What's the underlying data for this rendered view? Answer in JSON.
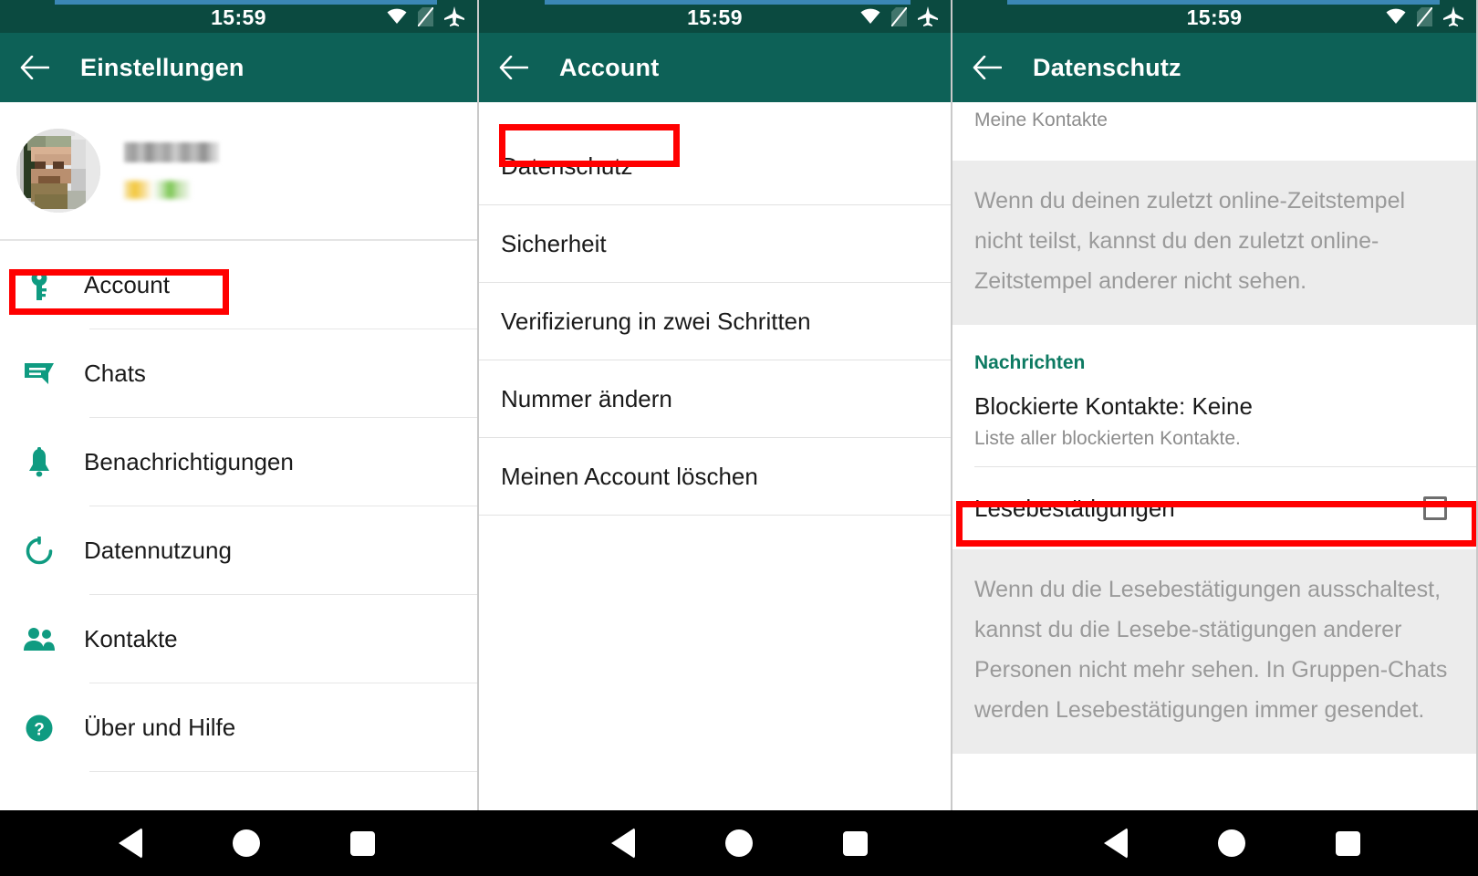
{
  "statusbar": {
    "time": "15:59",
    "icons": [
      "wifi-icon",
      "no-sim-icon",
      "airplane-mode-icon"
    ]
  },
  "colors": {
    "appbar_green": "#0d6157",
    "statusbar_green": "#0b4a40",
    "accent_teal": "#0d7a62",
    "progress_blue": "#3b87b5",
    "highlight_red": "#ff0000",
    "info_bg": "#ececec"
  },
  "panel_settings": {
    "appbar": {
      "title": "Einstellungen",
      "back_icon": "back-arrow-icon"
    },
    "profile": {
      "name": "",
      "status": "",
      "avatar_alt": "profile-photo"
    },
    "items": [
      {
        "label": "Account",
        "icon": "key-icon",
        "highlighted": true
      },
      {
        "label": "Chats",
        "icon": "chat-bubble-icon",
        "highlighted": false
      },
      {
        "label": "Benachrichtigungen",
        "icon": "bell-icon",
        "highlighted": false
      },
      {
        "label": "Datennutzung",
        "icon": "data-usage-icon",
        "highlighted": false
      },
      {
        "label": "Kontakte",
        "icon": "contacts-icon",
        "highlighted": false
      },
      {
        "label": "Über und Hilfe",
        "icon": "help-icon",
        "highlighted": false
      }
    ]
  },
  "panel_account": {
    "appbar": {
      "title": "Account",
      "back_icon": "back-arrow-icon"
    },
    "items": [
      {
        "label": "Datenschutz",
        "highlighted": true
      },
      {
        "label": "Sicherheit",
        "highlighted": false
      },
      {
        "label": "Verifizierung in zwei Schritten",
        "highlighted": false
      },
      {
        "label": "Nummer ändern",
        "highlighted": false
      },
      {
        "label": "Meinen Account löschen",
        "highlighted": false
      }
    ]
  },
  "panel_privacy": {
    "appbar": {
      "title": "Datenschutz",
      "back_icon": "back-arrow-icon"
    },
    "cut_off_value": "Meine Kontakte",
    "info_last_seen": "Wenn du deinen zuletzt online-Zeitstempel nicht teilst, kannst du den zuletzt online-Zeitstempel anderer nicht sehen.",
    "section_messages": "Nachrichten",
    "blocked": {
      "title": "Blockierte Kontakte: Keine",
      "subtitle": "Liste aller blockierten Kontakte."
    },
    "read_receipts": {
      "label": "Lesebestätigungen",
      "checked": false,
      "highlighted": true
    },
    "info_read_receipts": "Wenn du die Lesebestätigungen ausschaltest, kannst du die Lesebe-stätigungen anderer Personen nicht mehr sehen. In Gruppen-Chats werden Lesebestätigungen immer gesendet."
  },
  "navbar": {
    "buttons": [
      "back-button",
      "home-button",
      "recents-button"
    ]
  }
}
